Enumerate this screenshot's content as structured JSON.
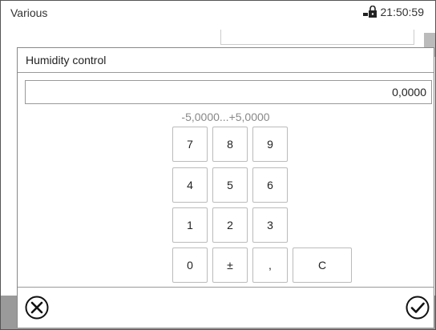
{
  "statusbar": {
    "title": "Various",
    "time": "21:50:59",
    "lock_icon": "lock-icon"
  },
  "dialog": {
    "title": "Humidity control",
    "value": "0,0000",
    "range": "-5,0000...+5,0000"
  },
  "keypad": {
    "keys": [
      "7",
      "8",
      "9",
      "4",
      "5",
      "6",
      "1",
      "2",
      "3",
      "0",
      "±",
      ",",
      "C"
    ]
  },
  "footer": {
    "cancel_icon": "cancel-icon",
    "confirm_icon": "confirm-icon"
  }
}
